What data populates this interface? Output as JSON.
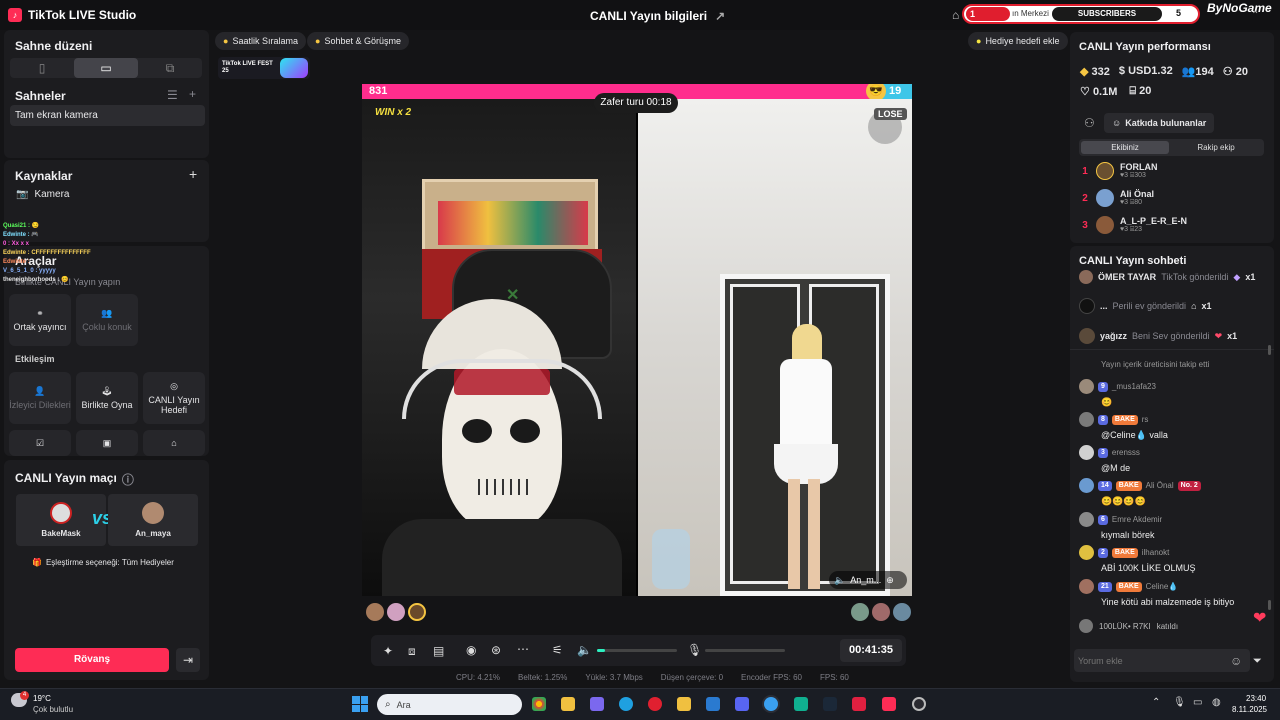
{
  "app": {
    "title": "TikTok LIVE Studio",
    "center_title": "CANLI Yayın bilgileri",
    "stream_label": "SUBSCRIBERS",
    "stream_count": "5",
    "brand": "ByNoGame",
    "help_partial": "ın Merkezi",
    "notif_count": "1"
  },
  "left": {
    "layout_title": "Sahne düzeni",
    "scenes_title": "Sahneler",
    "scene_item": "Tam ekran kamera",
    "sources_title": "Kaynaklar",
    "source_item": "Kamera",
    "tools_title": "Araçlar",
    "collab_title": "Birlikte CANLI Yayın yapın",
    "collab_btn1": "Ortak yayıncı",
    "collab_btn2": "Çoklu konuk",
    "interact_title": "Etkileşim",
    "interact_btn1": "İzleyici Dilekleri",
    "interact_btn2": "Birlikte Oyna",
    "interact_btn3": "CANLI Yayın Hedefi",
    "match_title": "CANLI Yayın maçı",
    "player1": "BakeMask",
    "player2": "An_maya",
    "match_setting": "Eşleştirme seçeneği: Tüm Hediyeler",
    "rematch": "Rövanş"
  },
  "overlay_chat": [
    "Quasi21 : 😏",
    "Edwinte : 🎮",
    "0 : Xx x x",
    "Edwinte : CFFFFFFFFFFFFFFF",
    "Edwinte : ",
    "V_6_5_1_0 : yyyyy",
    "theneighborhoods : 😊"
  ],
  "top_chips": {
    "ranking": "Saatlik Sıralama",
    "chat": "Sohbet & Görüşme",
    "gift_goal": "Hediye hedefi ekle"
  },
  "fest_label": "TikTok LIVE FEST 25",
  "battle": {
    "left_score": "831",
    "right_score": "19",
    "round": "Zafer turu 00:18",
    "win_label": "WIN x 2",
    "lose_label": "LOSE",
    "guest_name": "An_m..."
  },
  "controls": {
    "timer": "00:41:35"
  },
  "stats": {
    "cpu": "CPU: 4.21%",
    "delay": "Beltek: 1.25%",
    "upload": "Yükle: 3.7 Mbps",
    "dropped": "Düşen çerçeve: 0",
    "encoder_fps": "Encoder FPS: 60",
    "fps": "FPS: 60"
  },
  "performance": {
    "title": "CANLI Yayın performansı",
    "coins": "332",
    "usd": "USD1.32",
    "viewers": "194",
    "gifters": "20",
    "likes": "0.1M",
    "gifts": "20",
    "contributors": "Katkıda bulunanlar",
    "tab_team": "Ekibiniz",
    "tab_rival": "Rakip ekip",
    "rank": [
      {
        "n": "1",
        "name": "FORLAN",
        "hearts": "3",
        "pts": "303"
      },
      {
        "n": "2",
        "name": "Ali Önal",
        "hearts": "3",
        "pts": "80"
      },
      {
        "n": "3",
        "name": "A_L-P_E-R_E-N",
        "hearts": "3",
        "pts": "23"
      }
    ]
  },
  "chat": {
    "title": "CANLI Yayın sohbeti",
    "gifts": [
      {
        "user": "ÖMER TAYAR",
        "text": "TikTok gönderildi",
        "count": "x1"
      },
      {
        "user": "...",
        "text": "Perili ev gönderildi",
        "count": "x1"
      },
      {
        "user": "yağızz",
        "text": "Beni Sev gönderildi",
        "count": "x1"
      }
    ],
    "follow_note": "Yayın içerik üreticisini takip etti",
    "messages": [
      {
        "lvl": "9",
        "team": "",
        "user": "_mus1afa23",
        "msg": "😊"
      },
      {
        "lvl": "8",
        "team": "BAKE",
        "user": "rs",
        "msg": "@Celine💧 valla"
      },
      {
        "lvl": "3",
        "team": "",
        "user": "erensss",
        "msg": "@M de"
      },
      {
        "lvl": "14",
        "team": "BAKE",
        "user": "Ali Önal",
        "extra": "No. 2",
        "msg": "😊😊😊😊"
      },
      {
        "lvl": "6",
        "team": "",
        "user": "Emre Akdemir",
        "msg": "kıymalı börek"
      },
      {
        "lvl": "2",
        "team": "BAKE",
        "user": "ilhanokt",
        "msg": "ABİ 100K LİKE OLMUŞ"
      },
      {
        "lvl": "21",
        "team": "BAKE",
        "user": "Celine💧",
        "msg": "Yine kötü abi malzemede iş bitiyo"
      }
    ],
    "joined_user": "100LÜK• R7KI",
    "joined_text": "katıldı",
    "input_placeholder": "Yorum ekle"
  },
  "taskbar": {
    "weather_temp": "19°C",
    "weather_desc": "Çok bulutlu",
    "search": "Ara",
    "time": "23:40",
    "date": "8.11.2025"
  }
}
